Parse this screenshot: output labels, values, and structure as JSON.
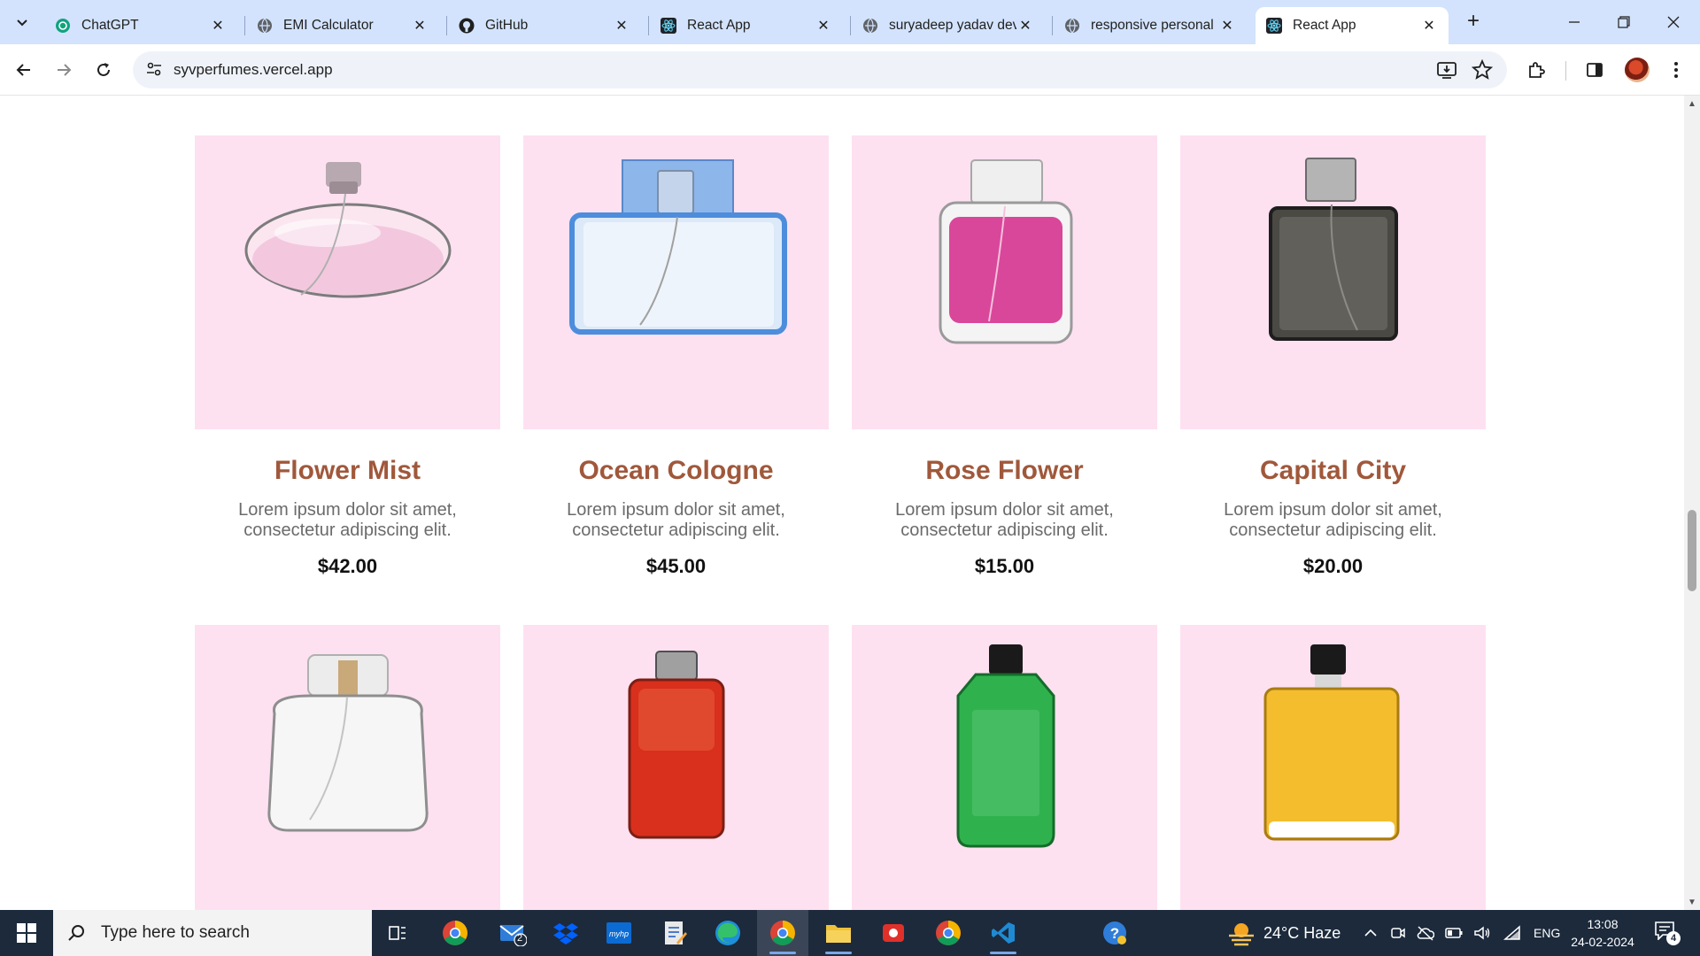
{
  "browser": {
    "tabs": [
      {
        "title": "ChatGPT",
        "favicon": "chatgpt-icon"
      },
      {
        "title": "EMI Calculator",
        "favicon": "globe-icon"
      },
      {
        "title": "GitHub",
        "favicon": "github-icon"
      },
      {
        "title": "React App",
        "favicon": "react-icon"
      },
      {
        "title": "suryadeep yadav dev",
        "favicon": "globe-icon"
      },
      {
        "title": "responsive personal",
        "favicon": "globe-icon"
      },
      {
        "title": "React App",
        "favicon": "react-icon",
        "active": true
      }
    ],
    "url": "syvperfumes.vercel.app"
  },
  "products": [
    {
      "name": "Flower Mist",
      "description": "Lorem ipsum dolor sit amet, consectetur adipiscing elit.",
      "price": "$42.00",
      "liquid": "#f3c8df",
      "cap": "#c9b8c0"
    },
    {
      "name": "Ocean Cologne",
      "description": "Lorem ipsum dolor sit amet, consectetur adipiscing elit.",
      "price": "$45.00",
      "liquid": "#dbe9f8",
      "cap": "#8db6ea"
    },
    {
      "name": "Rose Flower",
      "description": "Lorem ipsum dolor sit amet, consectetur adipiscing elit.",
      "price": "$15.00",
      "liquid": "#d9479a",
      "cap": "#e8e8e8"
    },
    {
      "name": "Capital City",
      "description": "Lorem ipsum dolor sit amet, consectetur adipiscing elit.",
      "price": "$20.00",
      "liquid": "#4a4944",
      "cap": "#8a8a8a"
    },
    {
      "name": "",
      "description": "",
      "price": "",
      "liquid": "#f4f4f4",
      "cap": "#c9a97a"
    },
    {
      "name": "",
      "description": "",
      "price": "",
      "liquid": "#d8301c",
      "cap": "#8c8c8c"
    },
    {
      "name": "",
      "description": "",
      "price": "",
      "liquid": "#2fb24e",
      "cap": "#1a1a1a"
    },
    {
      "name": "",
      "description": "",
      "price": "",
      "liquid": "#f4bd2e",
      "cap": "#1a1a1a"
    }
  ],
  "taskbar": {
    "search_placeholder": "Type here to search",
    "mail_badge": "2",
    "weather": "24°C  Haze",
    "language": "ENG",
    "time": "13:08",
    "date": "24-02-2024",
    "notifications": "4"
  },
  "colors": {
    "card_bg": "#fde1f1",
    "product_title": "#a0583b",
    "tabbar": "#d3e3fd",
    "taskbar": "#1c2a3c"
  }
}
